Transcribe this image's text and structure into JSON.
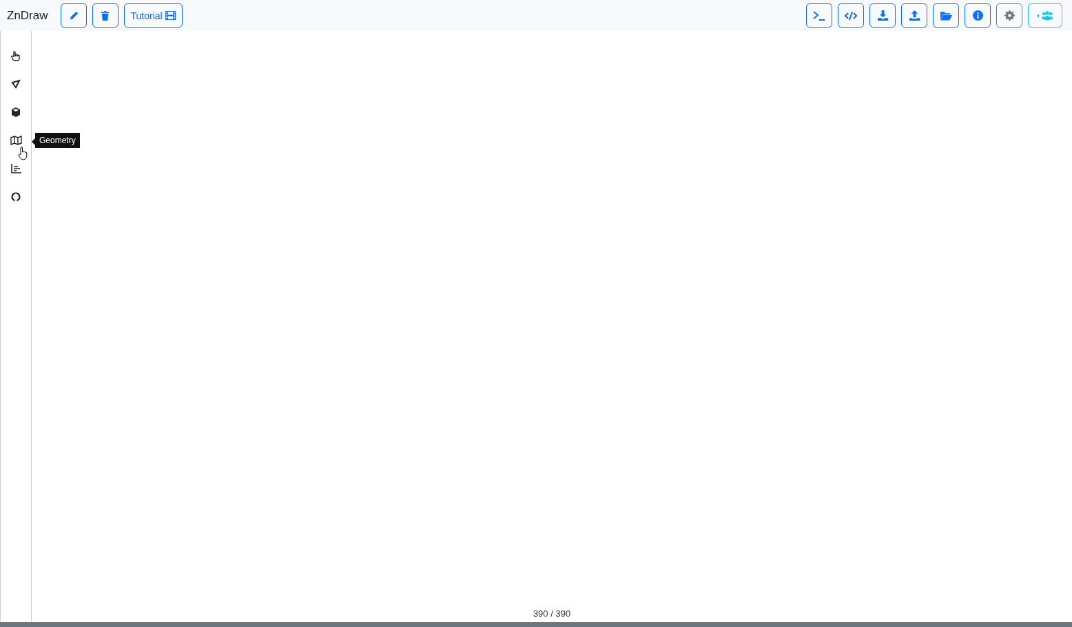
{
  "header": {
    "title": "ZnDraw",
    "left_buttons": [
      {
        "color": "#0d6efd"
      },
      {
        "color": "#0d6efd"
      },
      {
        "label": "Tutorial",
        "color": "#0d6efd"
      }
    ],
    "right_buttons": [
      {
        "color": "#0d6efd"
      },
      {
        "color": "#0d6efd"
      },
      {
        "color": "#0d6efd"
      },
      {
        "color": "#0d6efd"
      },
      {
        "color": "#0d6efd"
      },
      {
        "color": "#0d6efd"
      },
      {
        "color": "#6c757d"
      },
      {
        "color": "#0dcaf0"
      }
    ]
  },
  "sidebar": {
    "tooltip": "Geometry"
  },
  "footer": {
    "frame_counter": "390 / 390",
    "progress": {
      "level": 1
    }
  }
}
